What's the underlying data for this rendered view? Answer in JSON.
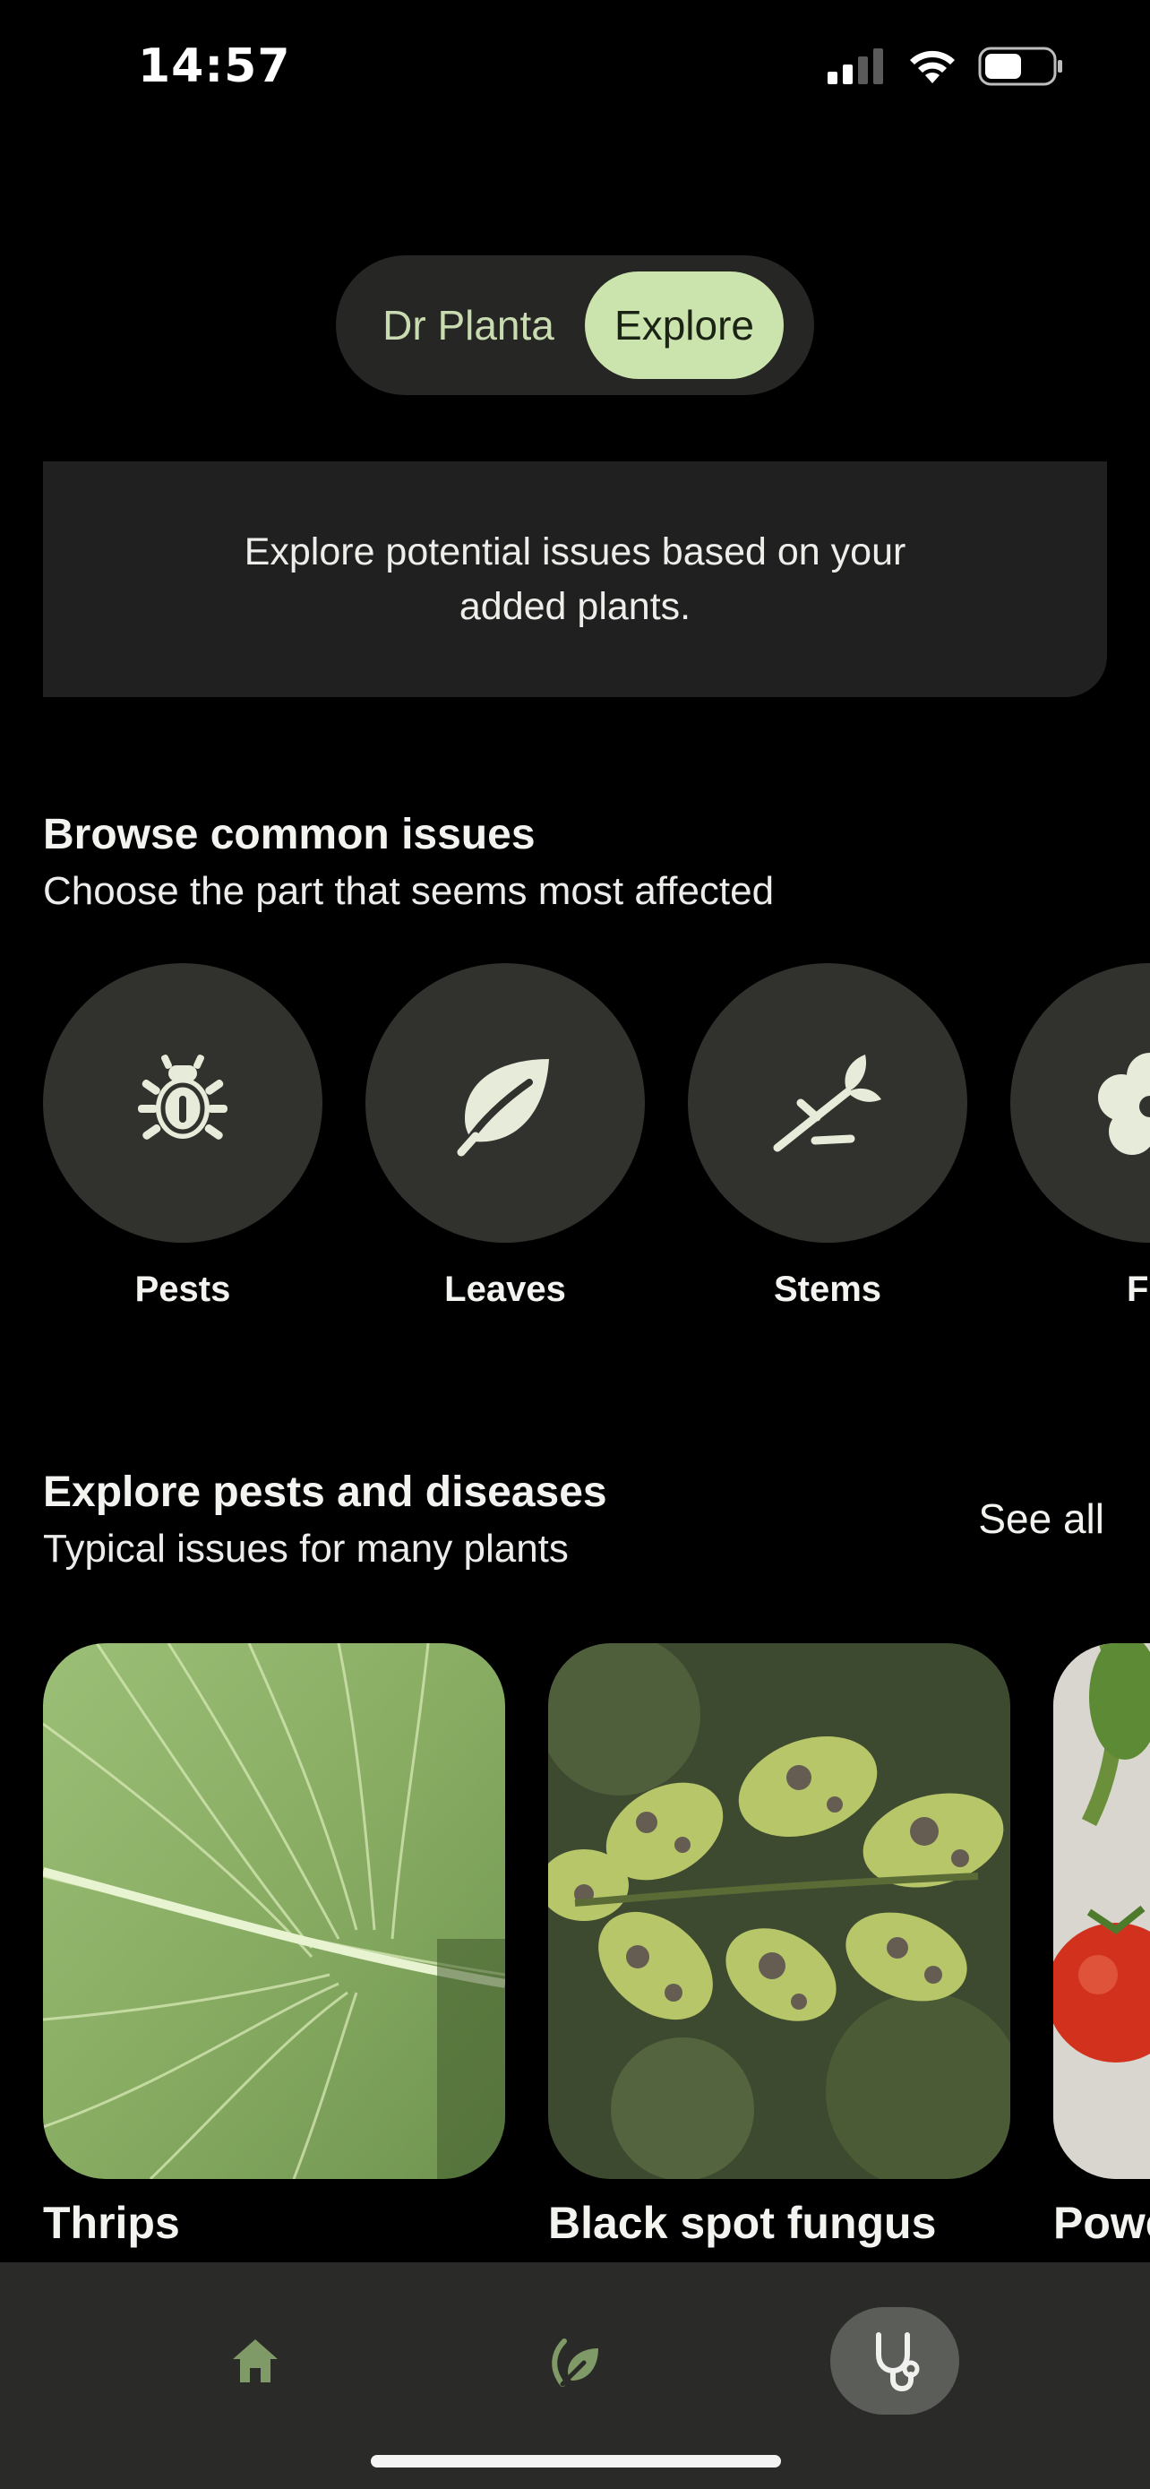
{
  "status": {
    "time": "14:57"
  },
  "segment": {
    "left_label": "Dr Planta",
    "right_label": "Explore",
    "selected": "Explore"
  },
  "info": {
    "text": "Explore potential issues based on your added plants."
  },
  "browse": {
    "title": "Browse common issues",
    "subtitle": "Choose the part that seems most affected",
    "items": [
      {
        "label": "Pests",
        "icon": "bug-icon"
      },
      {
        "label": "Leaves",
        "icon": "leaf-icon"
      },
      {
        "label": "Stems",
        "icon": "stem-icon"
      },
      {
        "label": "Flow",
        "icon": "flower-icon"
      }
    ]
  },
  "explore": {
    "title": "Explore pests and diseases",
    "subtitle": "Typical issues for many plants",
    "see_all": "See all",
    "cards": [
      {
        "name": "Thrips"
      },
      {
        "name": "Black spot fungus"
      },
      {
        "name": "Powe"
      }
    ]
  },
  "tabbar": {
    "items": [
      {
        "icon": "home-icon",
        "active": false
      },
      {
        "icon": "plant-icon",
        "active": false
      },
      {
        "icon": "stethoscope-icon",
        "active": true
      }
    ]
  },
  "colors": {
    "accent": "#cbe4ae",
    "card_bg": "#202020",
    "circle_bg": "#31322d",
    "tabbar_bg": "#2a2b28"
  }
}
